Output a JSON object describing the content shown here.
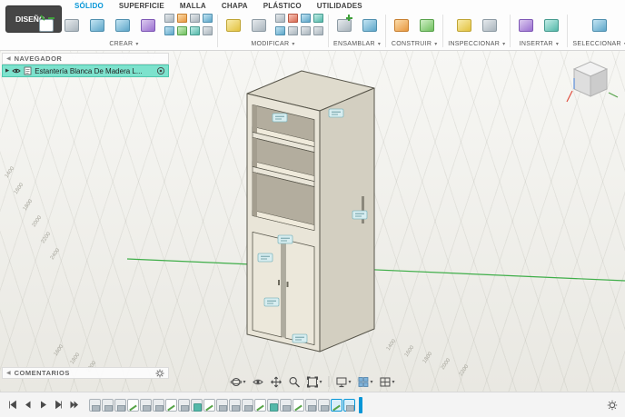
{
  "app_bar": {
    "design_menu_label": "DISEÑO"
  },
  "tabs": [
    {
      "label": "SÓLIDO",
      "active": true
    },
    {
      "label": "SUPERFICIE",
      "active": false
    },
    {
      "label": "MALLA",
      "active": false
    },
    {
      "label": "CHAPA",
      "active": false
    },
    {
      "label": "PLÁSTICO",
      "active": false
    },
    {
      "label": "UTILIDADES",
      "active": false
    }
  ],
  "ribbon_groups": [
    {
      "label": "CREAR"
    },
    {
      "label": "MODIFICAR"
    },
    {
      "label": "ENSAMBLAR"
    },
    {
      "label": "CONSTRUIR"
    },
    {
      "label": "INSPECCIONAR"
    },
    {
      "label": "INSERTAR"
    },
    {
      "label": "SELECCIONAR"
    }
  ],
  "navigator": {
    "title": "NAVEGADOR",
    "document_label": "Estantería Blanca De Madera L..."
  },
  "comments": {
    "title": "COMENTARIOS"
  },
  "viewport": {
    "grid_labels_left": [
      "1400",
      "1600",
      "1800",
      "2000",
      "2200",
      "2400"
    ],
    "grid_labels_corner": [
      "1600",
      "1800",
      "2000"
    ],
    "grid_labels_bottom": [
      "1400",
      "1600",
      "1800",
      "2000",
      "2200"
    ]
  },
  "glyphs": {
    "caret": "▾",
    "collapse_left": "◀",
    "expander": "▶"
  },
  "colors": {
    "accent_blue": "#0696d7",
    "selection_teal": "#7de2cd",
    "axis_green": "#3fae49",
    "badge_fill": "#d7edf0",
    "model_front": "#e9e5d8",
    "model_side": "#d3cfc1",
    "model_top": "#dfdbcd"
  }
}
